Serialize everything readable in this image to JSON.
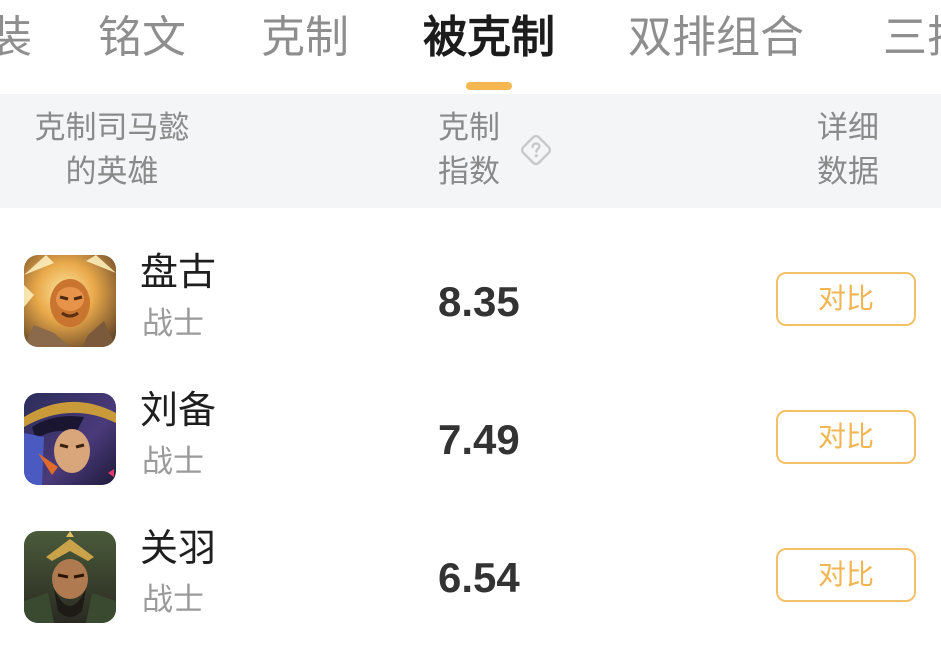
{
  "tabs": [
    {
      "label": "装"
    },
    {
      "label": "铭文"
    },
    {
      "label": "克制"
    },
    {
      "label": "被克制"
    },
    {
      "label": "双排组合"
    },
    {
      "label": "三排"
    }
  ],
  "active_tab": "被克制",
  "header": {
    "hero_col_line1": "克制司马懿",
    "hero_col_line2": "的英雄",
    "index_col_line1": "克制",
    "index_col_line2": "指数",
    "detail_col_line1": "详细",
    "detail_col_line2": "数据"
  },
  "colors": {
    "accent": "#f5b74f",
    "button_border": "#f5c06a",
    "header_bg": "#f4f5f7"
  },
  "rows": [
    {
      "name": "盘古",
      "role": "战士",
      "score": "8.35",
      "button": "对比",
      "avatar_icon": "pangu-avatar"
    },
    {
      "name": "刘备",
      "role": "战士",
      "score": "7.49",
      "button": "对比",
      "avatar_icon": "liubei-avatar"
    },
    {
      "name": "关羽",
      "role": "战士",
      "score": "6.54",
      "button": "对比",
      "avatar_icon": "guanyu-avatar"
    }
  ]
}
